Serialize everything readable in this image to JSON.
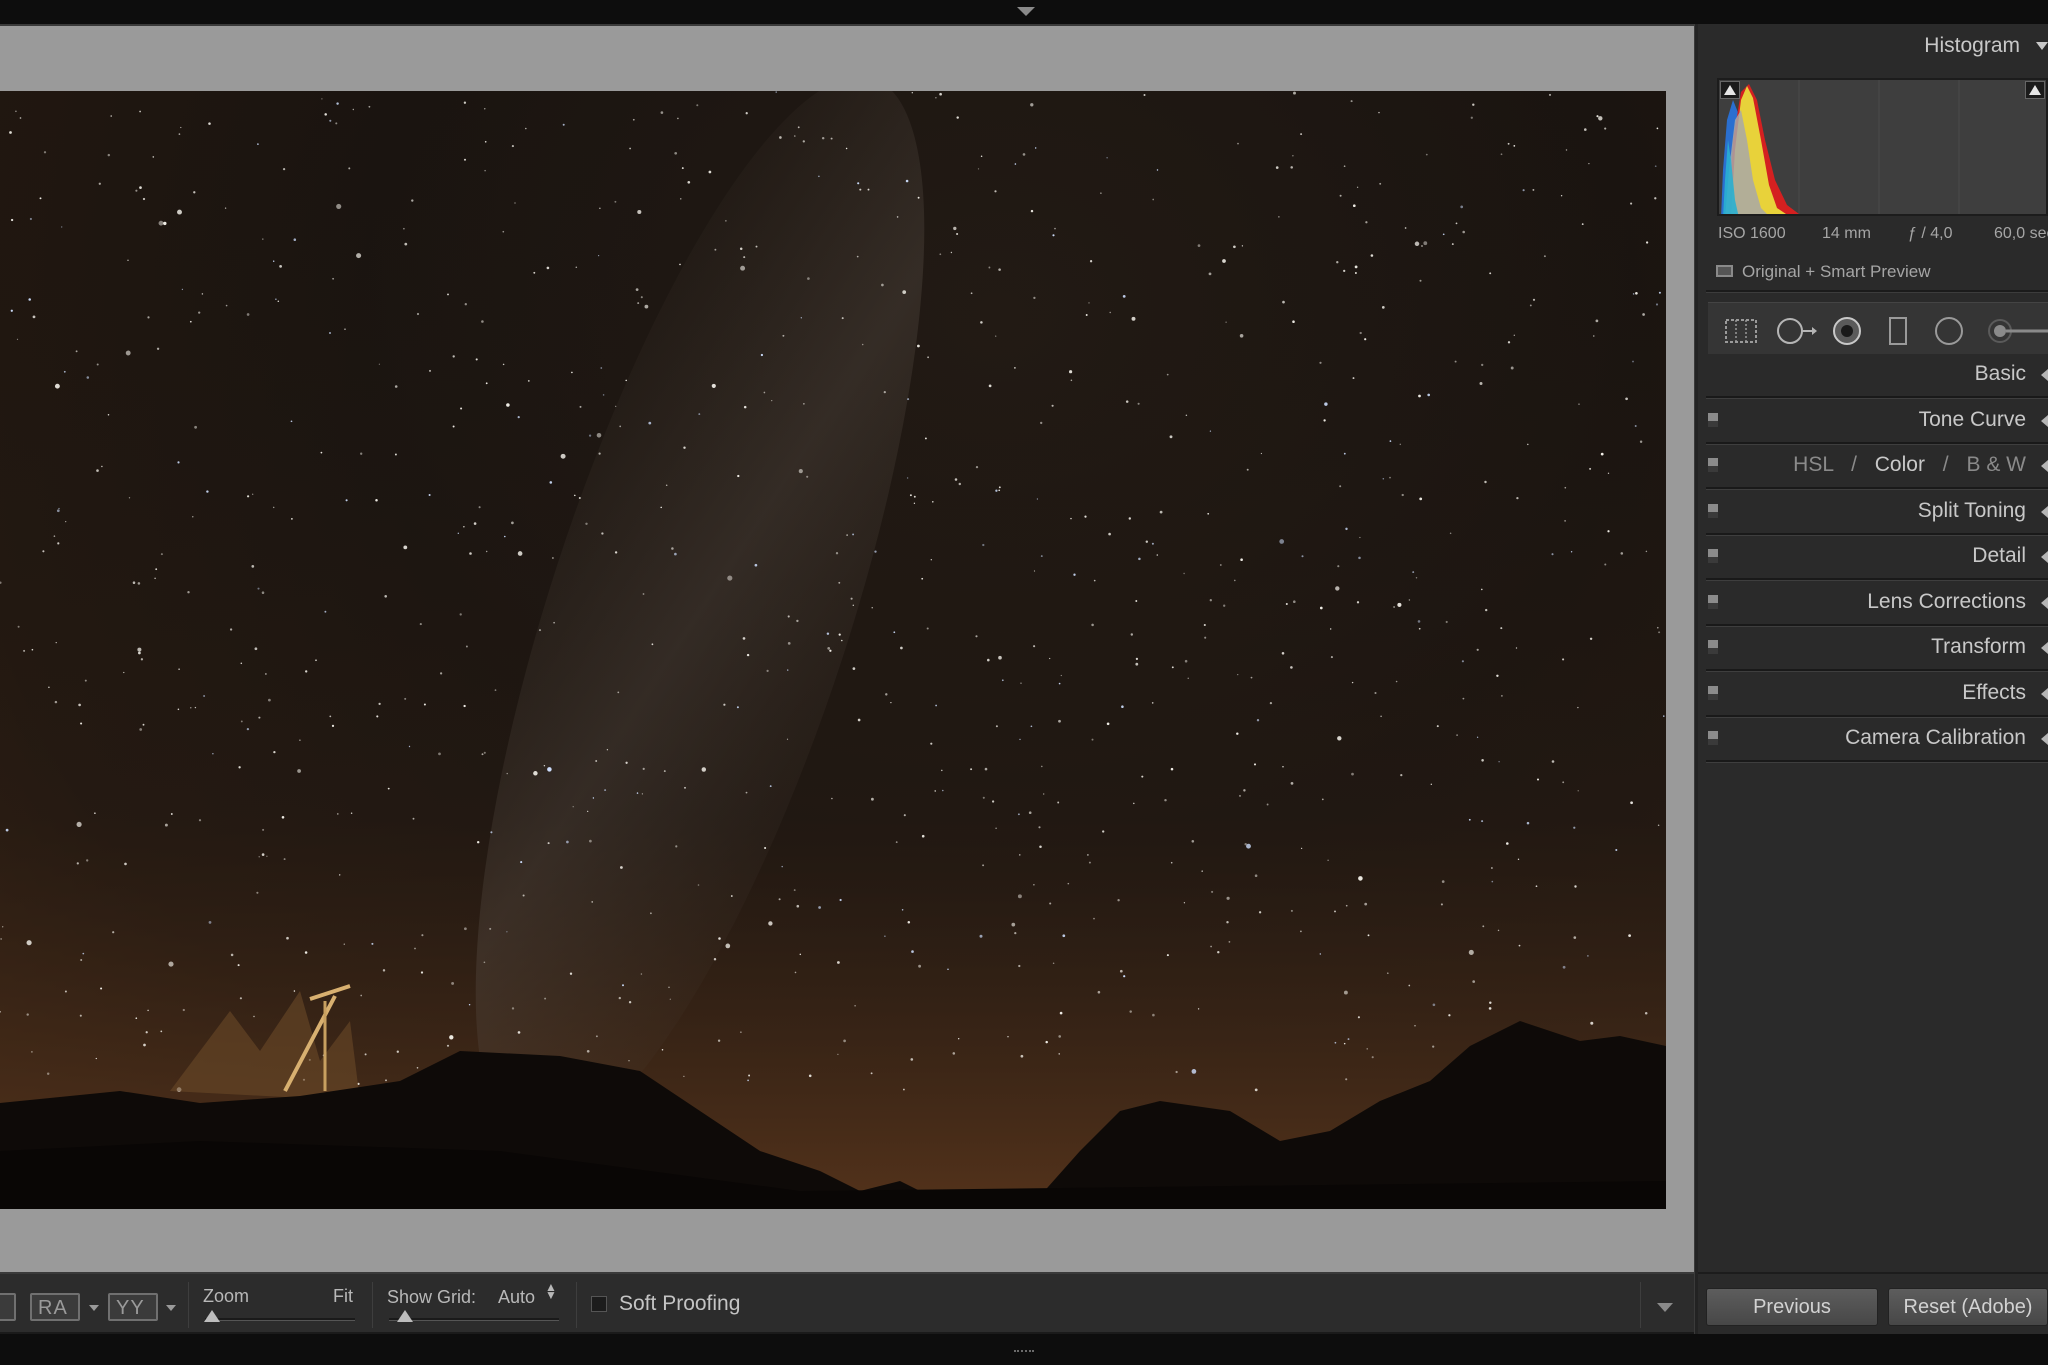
{
  "top_bar": {
    "toggle_icon": "chevron-down-icon"
  },
  "toolbar": {
    "before_after_lr": "RA",
    "before_after_tb": "YY",
    "zoom_label": "Zoom",
    "zoom_value": "Fit",
    "grid_label": "Show Grid:",
    "grid_value": "Auto",
    "soft_proofing_label": "Soft Proofing",
    "soft_proofing_checked": false
  },
  "histogram": {
    "title": "Histogram",
    "iso": "ISO 1600",
    "focal_length": "14 mm",
    "aperture": "ƒ / 4,0",
    "shutter": "60,0 sec",
    "preview_status": "Original + Smart Preview"
  },
  "tools": [
    {
      "name": "crop-overlay-icon"
    },
    {
      "name": "spot-removal-icon"
    },
    {
      "name": "red-eye-icon"
    },
    {
      "name": "graduated-filter-icon"
    },
    {
      "name": "radial-filter-icon"
    },
    {
      "name": "adjustment-brush-icon"
    }
  ],
  "sections": {
    "basic": "Basic",
    "tone_curve": "Tone Curve",
    "hsl": "HSL",
    "slash": "/",
    "color": "Color",
    "bw": "B & W",
    "split_toning": "Split Toning",
    "detail": "Detail",
    "lens_corrections": "Lens Corrections",
    "transform": "Transform",
    "effects": "Effects",
    "camera_calibration": "Camera Calibration"
  },
  "footer": {
    "previous_label": "Previous",
    "reset_label": "Reset (Adobe)"
  },
  "colors": {
    "panel_bg": "#2a2a2a",
    "viewer_bg": "#9a9a9a",
    "text_light": "#c8c8c8",
    "histogram_yellow": "#e8d23a",
    "histogram_red": "#d42020",
    "histogram_blue": "#2a6fd0"
  }
}
